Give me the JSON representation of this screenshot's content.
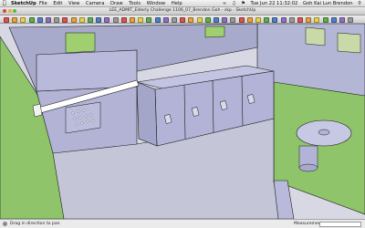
{
  "menubar": {
    "app_name": "SketchUp",
    "menus": [
      "File",
      "Edit",
      "View",
      "Camera",
      "Draw",
      "Tools",
      "Window",
      "Help"
    ],
    "clock": "Tue Jun 22  11:32:02",
    "user": "Goh Kai Lun Brendon"
  },
  "window": {
    "title": "LEE_ADMIT_Elderly Challenge 1106_07_Brendon Goh - skp - SketchUp"
  },
  "toolbar": {
    "tools": [
      "select",
      "eraser",
      "paint-bucket",
      "line",
      "arc",
      "rectangle",
      "circle",
      "polygon",
      "push-pull",
      "move",
      "rotate",
      "scale",
      "offset",
      "follow-me",
      "tape-measure",
      "protractor",
      "text",
      "axes",
      "dimension",
      "orbit",
      "pan",
      "zoom",
      "zoom-window",
      "zoom-extents",
      "previous",
      "next",
      "walk",
      "look-around",
      "position-camera",
      "section-plane",
      "iso",
      "top",
      "front",
      "right",
      "back",
      "left",
      "xray",
      "wireframe",
      "hidden-line",
      "shaded",
      "textured",
      "monochrome"
    ],
    "colors": {
      "red": "#d9534f",
      "orange": "#e8a13c",
      "yellow": "#e7d34a",
      "green": "#5fae4f",
      "blue": "#4f7fc9",
      "purple": "#8f6fbf",
      "grey": "#9a9a9a"
    }
  },
  "statusbar": {
    "hint": "Drag in direction to pan",
    "measurements_label": "Measurements",
    "measurements_value": ""
  },
  "scene": {
    "wall_color": "#b9badb",
    "floor_color": "#c4c6d8",
    "ground_color": "#8fc46a",
    "edge_color": "#1a1a1a",
    "window_sky_color": "#c9d9a8"
  }
}
